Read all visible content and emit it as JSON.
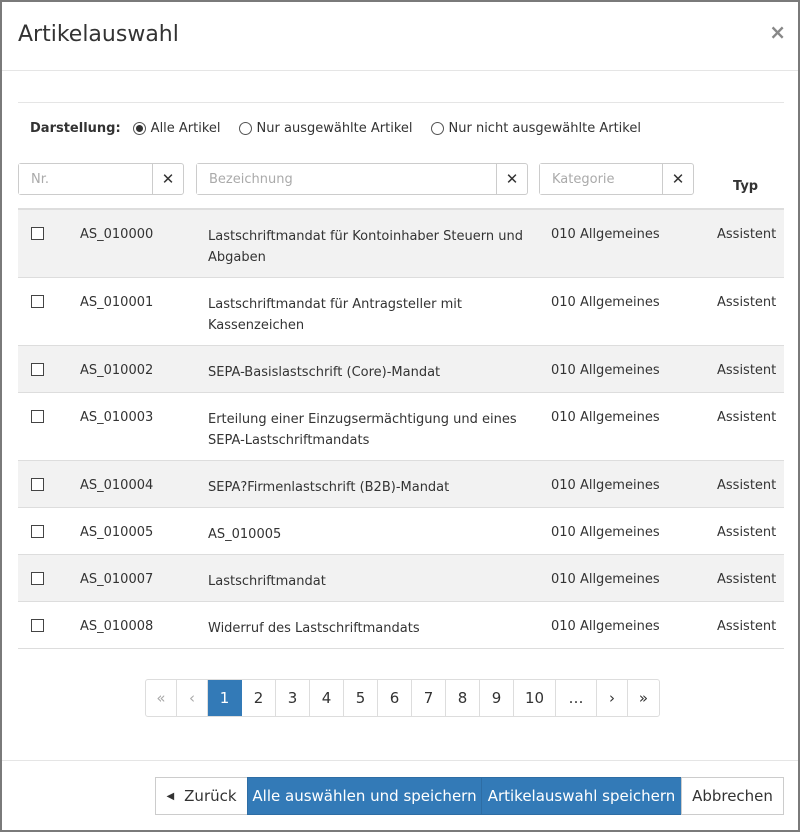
{
  "dialog": {
    "title": "Artikelauswahl",
    "close_label": "×"
  },
  "display": {
    "label": "Darstellung:",
    "options": [
      {
        "label": "Alle Artikel",
        "checked": true
      },
      {
        "label": "Nur ausgewählte Artikel",
        "checked": false
      },
      {
        "label": "Nur nicht ausgewählte Artikel",
        "checked": false
      }
    ]
  },
  "filters": {
    "nr_placeholder": "Nr.",
    "bez_placeholder": "Bezeichnung",
    "kat_placeholder": "Kategorie",
    "clear_label": "✕"
  },
  "columns": {
    "typ": "Typ"
  },
  "rows": [
    {
      "nr": "AS_010000",
      "bez": "Lastschriftmandat für Kontoinhaber Steuern und Abgaben",
      "kat": "010 Allgemeines",
      "typ": "Assistent"
    },
    {
      "nr": "AS_010001",
      "bez": "Lastschriftmandat für Antragsteller mit Kassenzeichen",
      "kat": "010 Allgemeines",
      "typ": "Assistent"
    },
    {
      "nr": "AS_010002",
      "bez": "SEPA-Basislastschrift (Core)-Mandat",
      "kat": "010 Allgemeines",
      "typ": "Assistent"
    },
    {
      "nr": "AS_010003",
      "bez": "Erteilung einer Einzugsermächtigung und eines SEPA-Lastschriftmandats",
      "kat": "010 Allgemeines",
      "typ": "Assistent"
    },
    {
      "nr": "AS_010004",
      "bez": "SEPA?Firmenlastschrift (B2B)-Mandat",
      "kat": "010 Allgemeines",
      "typ": "Assistent"
    },
    {
      "nr": "AS_010005",
      "bez": "AS_010005",
      "kat": "010 Allgemeines",
      "typ": "Assistent"
    },
    {
      "nr": "AS_010007",
      "bez": "Lastschriftmandat",
      "kat": "010 Allgemeines",
      "typ": "Assistent"
    },
    {
      "nr": "AS_010008",
      "bez": "Widerruf des Lastschriftmandats",
      "kat": "010 Allgemeines",
      "typ": "Assistent"
    }
  ],
  "pagination": {
    "first": "«",
    "prev": "‹",
    "pages": [
      "1",
      "2",
      "3",
      "4",
      "5",
      "6",
      "7",
      "8",
      "9",
      "10"
    ],
    "active": "1",
    "ellipsis": "…",
    "next": "›",
    "last": "»"
  },
  "buttons": {
    "back_arrow": "◀",
    "back": "Zurück",
    "select_all_save": "Alle auswählen und speichern",
    "save_selection": "Artikelauswahl speichern",
    "cancel": "Abbrechen"
  },
  "colors": {
    "primary": "#337ab7",
    "row_stripe": "#f2f2f2"
  }
}
